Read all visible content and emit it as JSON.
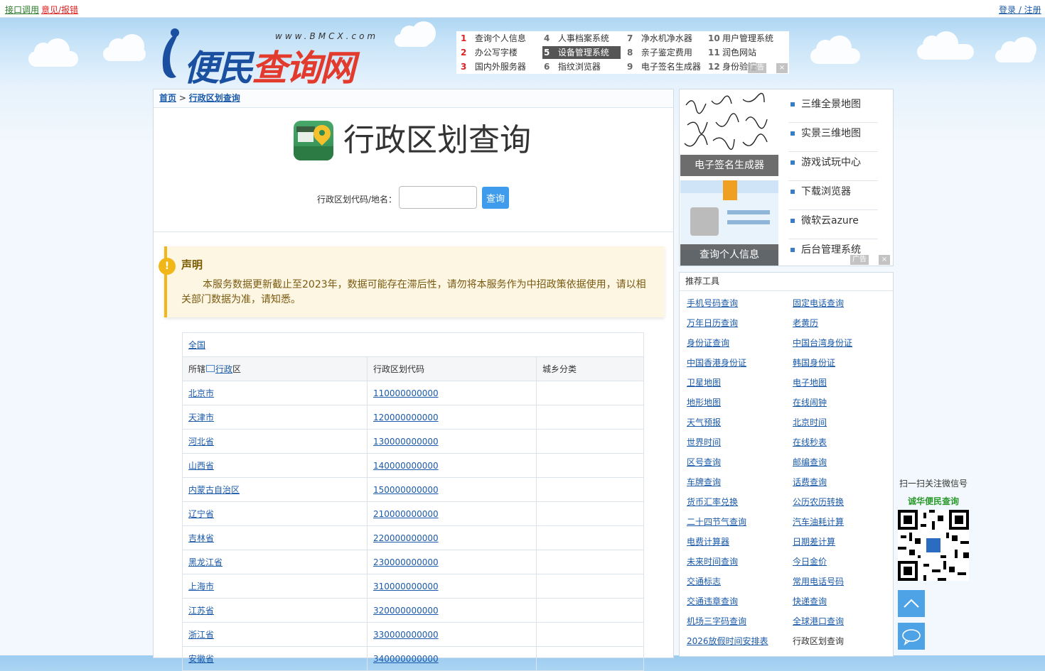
{
  "topbar": {
    "api_link": "接口调用",
    "feedback_link": "意见/报错",
    "login_link": "登录 / 注册"
  },
  "logo": {
    "url_text": "www.BMCX.com",
    "text_blue": "便民",
    "text_red": "查询网"
  },
  "top_links": [
    {
      "num": "1",
      "label": "查询个人信息"
    },
    {
      "num": "2",
      "label": "办公写字楼"
    },
    {
      "num": "3",
      "label": "国内外服务器"
    },
    {
      "num": "4",
      "label": "人事档案系统"
    },
    {
      "num": "5",
      "label": "设备管理系统"
    },
    {
      "num": "6",
      "label": "指纹浏览器"
    },
    {
      "num": "7",
      "label": "净水机净水器"
    },
    {
      "num": "8",
      "label": "亲子鉴定费用"
    },
    {
      "num": "9",
      "label": "电子签名生成器"
    },
    {
      "num": "10",
      "label": "用户管理系统"
    },
    {
      "num": "11",
      "label": "润色网站"
    },
    {
      "num": "12",
      "label": "身份验证"
    }
  ],
  "ad_tag": "广告",
  "breadcrumb": {
    "home": "首页",
    "sep": ">",
    "current": "行政区划查询"
  },
  "page_title": "行政区划查询",
  "search": {
    "label": "行政区划代码/地名：",
    "value": "",
    "button": "查询"
  },
  "notice": {
    "icon": "!",
    "title": "声明",
    "text": "本服务数据更新截止至2023年，数据可能存在滞后性，请勿将本服务作为中招政策依据使用，请以相关部门数据为准，请知悉。"
  },
  "table": {
    "all_link": "全国",
    "headers": {
      "col1_prefix": "所辖",
      "col1_link": "行政",
      "col1_suffix": "区",
      "col2": "行政区划代码",
      "col3": "城乡分类"
    },
    "rows": [
      {
        "name": "北京市",
        "code": "110000000000"
      },
      {
        "name": "天津市",
        "code": "120000000000"
      },
      {
        "name": "河北省",
        "code": "130000000000"
      },
      {
        "name": "山西省",
        "code": "140000000000"
      },
      {
        "name": "内蒙古自治区",
        "code": "150000000000"
      },
      {
        "name": "辽宁省",
        "code": "210000000000"
      },
      {
        "name": "吉林省",
        "code": "220000000000"
      },
      {
        "name": "黑龙江省",
        "code": "230000000000"
      },
      {
        "name": "上海市",
        "code": "310000000000"
      },
      {
        "name": "江苏省",
        "code": "320000000000"
      },
      {
        "name": "浙江省",
        "code": "330000000000"
      },
      {
        "name": "安徽省",
        "code": "340000000000"
      }
    ]
  },
  "side_ad": {
    "thumb1": "电子签名生成器",
    "thumb2": "查询个人信息",
    "list": [
      "三维全景地图",
      "实景三维地图",
      "游戏试玩中心",
      "下载浏览器",
      "微软云azure",
      "后台管理系统"
    ]
  },
  "tools": {
    "title": "推荐工具",
    "left": [
      "手机号码查询",
      "万年日历查询",
      "身份证查询",
      "中国香港身份证",
      "卫星地图",
      "地形地图",
      "天气预报",
      "世界时间",
      "区号查询",
      "车牌查询",
      "货币汇率兑换",
      "二十四节气查询",
      "电费计算器",
      "未来时间查询",
      "交通标志",
      "交通违章查询",
      "机场三字码查询",
      "2026放假时间安排表"
    ],
    "right": [
      "固定电话查询",
      "老黄历",
      "中国台湾身份证",
      "韩国身份证",
      "电子地图",
      "在线闹钟",
      "北京时间",
      "在线秒表",
      "邮编查询",
      "话费查询",
      "公历农历转换",
      "汽车油耗计算",
      "日期差计算",
      "今日金价",
      "常用电话号码",
      "快递查询",
      "全球港口查询",
      "行政区划查询"
    ]
  },
  "qr": {
    "caption1": "扫一扫关注微信号",
    "caption2": "诚华便民查询"
  }
}
